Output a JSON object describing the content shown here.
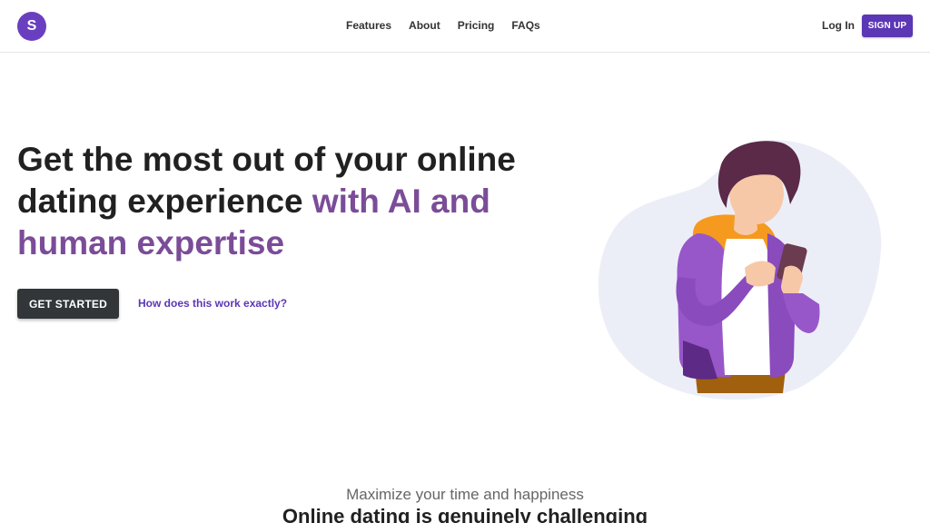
{
  "header": {
    "logo_letter": "S",
    "nav": [
      "Features",
      "About",
      "Pricing",
      "FAQs"
    ],
    "login_label": "Log In",
    "signup_label": "SIGN UP"
  },
  "hero": {
    "title_plain": "Get the most out of your online dating experience ",
    "title_accent": "with AI and human expertise",
    "primary_button": "GET STARTED",
    "secondary_link": "How does this work exactly?"
  },
  "section": {
    "kicker": "Maximize your time and happiness",
    "heading": "Online dating is genuinely challenging"
  },
  "colors": {
    "brand_purple": "#5b36b5",
    "accent_text": "#7b4c98",
    "dark_button": "#323639"
  }
}
